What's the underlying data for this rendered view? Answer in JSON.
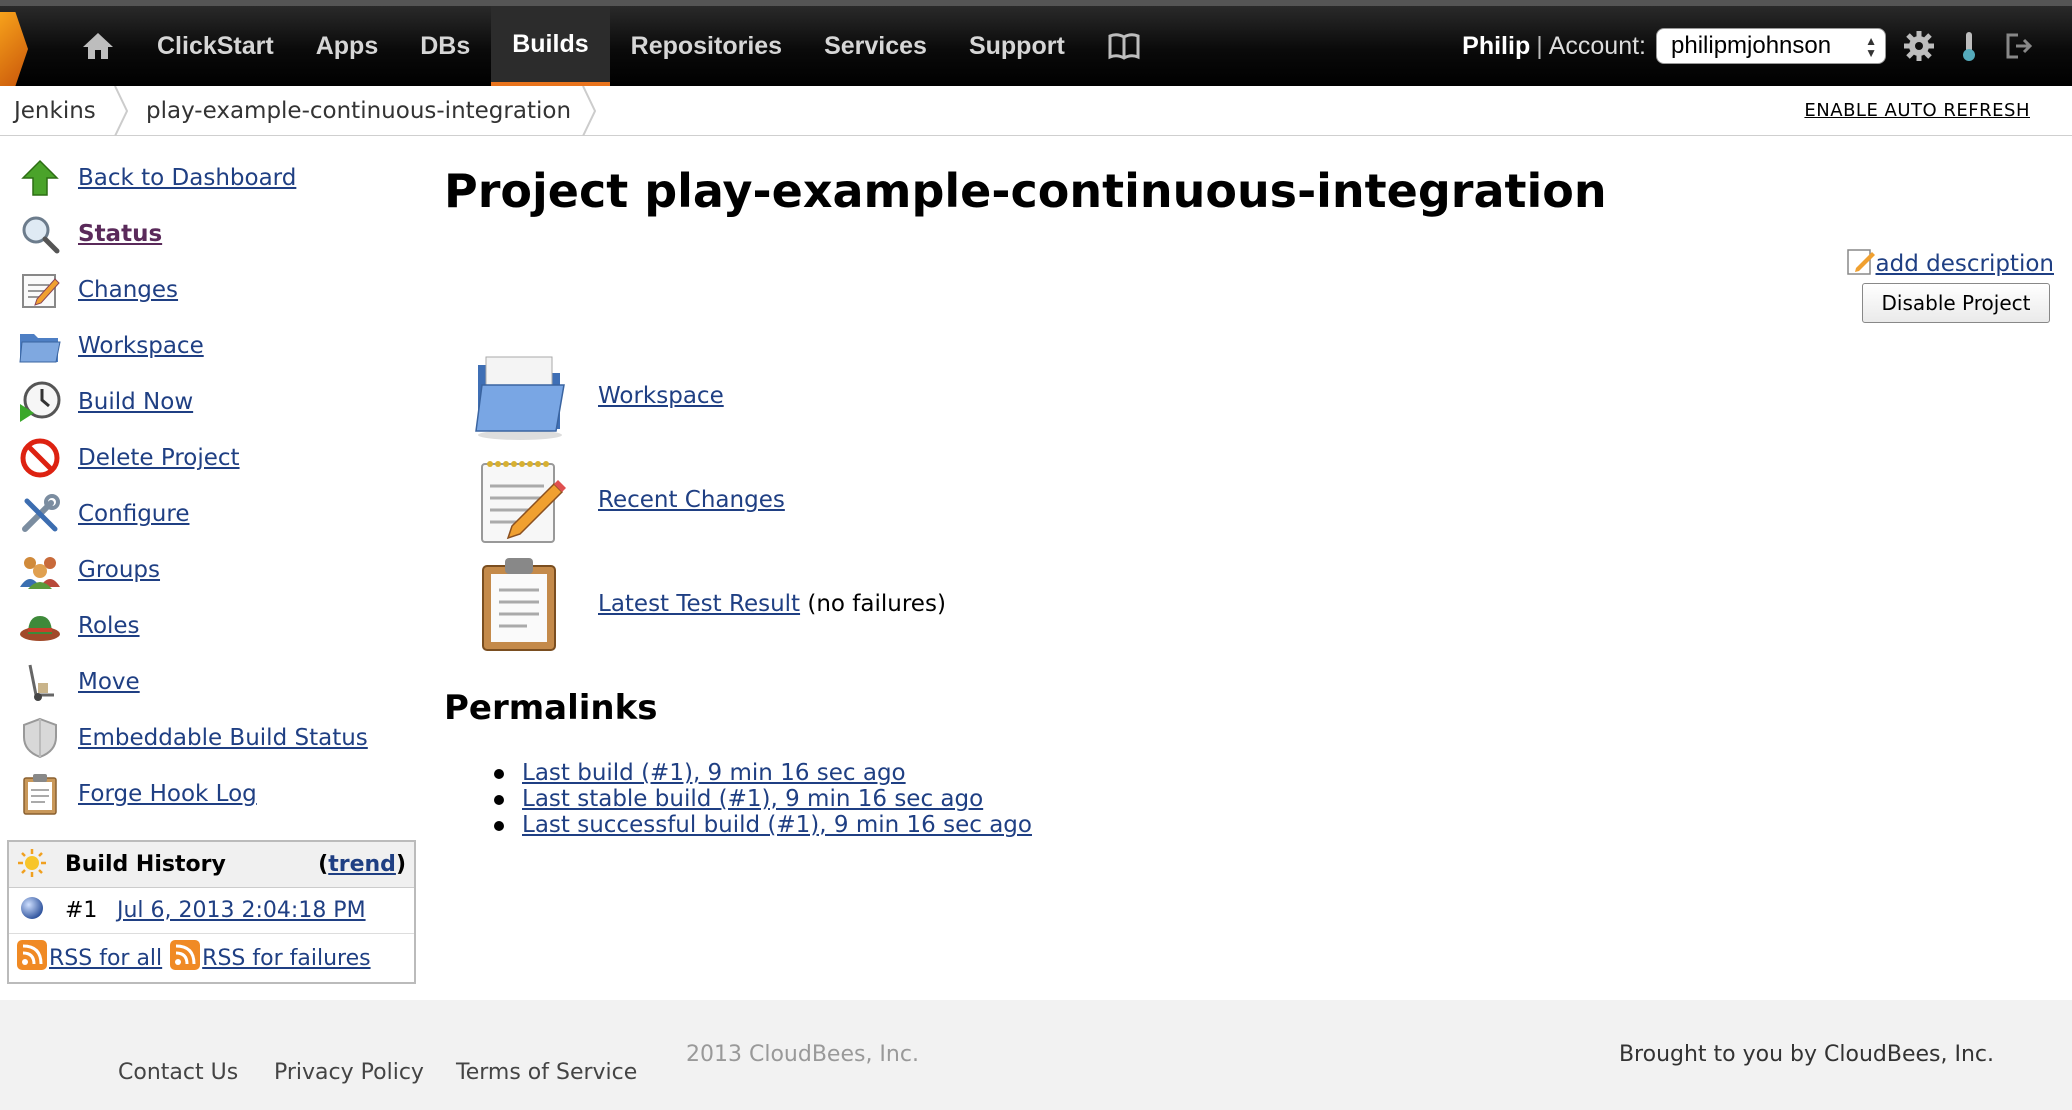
{
  "topbar": {
    "nav": [
      "ClickStart",
      "Apps",
      "DBs",
      "Builds",
      "Repositories",
      "Services",
      "Support"
    ],
    "active_nav": "Builds",
    "user_name": "Philip",
    "separator": "|",
    "account_label": "Account:",
    "account_value": "philipmjohnson",
    "brand_color": "#e9731c"
  },
  "breadcrumb": {
    "items": [
      "Jenkins",
      "play-example-continuous-integration"
    ],
    "auto_refresh": "ENABLE AUTO REFRESH"
  },
  "sidebar": {
    "items": [
      {
        "label": "Back to Dashboard",
        "icon": "up-arrow-icon"
      },
      {
        "label": "Status",
        "icon": "magnifier-icon"
      },
      {
        "label": "Changes",
        "icon": "notepad-icon"
      },
      {
        "label": "Workspace",
        "icon": "folder-icon"
      },
      {
        "label": "Build Now",
        "icon": "clock-play-icon"
      },
      {
        "label": "Delete Project",
        "icon": "no-entry-icon"
      },
      {
        "label": "Configure",
        "icon": "tools-icon"
      },
      {
        "label": "Groups",
        "icon": "people-group-icon"
      },
      {
        "label": "Roles",
        "icon": "hat-icon"
      },
      {
        "label": "Move",
        "icon": "hand-truck-icon"
      },
      {
        "label": "Embeddable Build Status",
        "icon": "shield-icon"
      },
      {
        "label": "Forge Hook Log",
        "icon": "clipboard-icon"
      }
    ]
  },
  "build_history": {
    "title": "Build History",
    "trend_open": "(",
    "trend_label": "trend",
    "trend_close": ")",
    "builds": [
      {
        "number": "#1",
        "date": "Jul 6, 2013 2:04:18 PM"
      }
    ],
    "rss_all": "RSS for all",
    "rss_failures": "RSS for failures"
  },
  "main": {
    "title": "Project play-example-continuous-integration",
    "add_description": "add description",
    "disable_button": "Disable Project",
    "links": [
      {
        "label": "Workspace",
        "suffix": ""
      },
      {
        "label": "Recent Changes",
        "suffix": ""
      },
      {
        "label": "Latest Test Result",
        "suffix": " (no failures)"
      }
    ],
    "permalinks_title": "Permalinks",
    "permalinks": [
      "Last build (#1), 9 min 16 sec ago",
      "Last stable build (#1), 9 min 16 sec ago",
      "Last successful build (#1), 9 min 16 sec ago"
    ]
  },
  "footer": {
    "links": [
      "Contact Us",
      "Privacy Policy",
      "Terms of Service"
    ],
    "copyright": "2013 CloudBees, Inc.",
    "brought_by": "Brought to you by CloudBees, Inc."
  }
}
